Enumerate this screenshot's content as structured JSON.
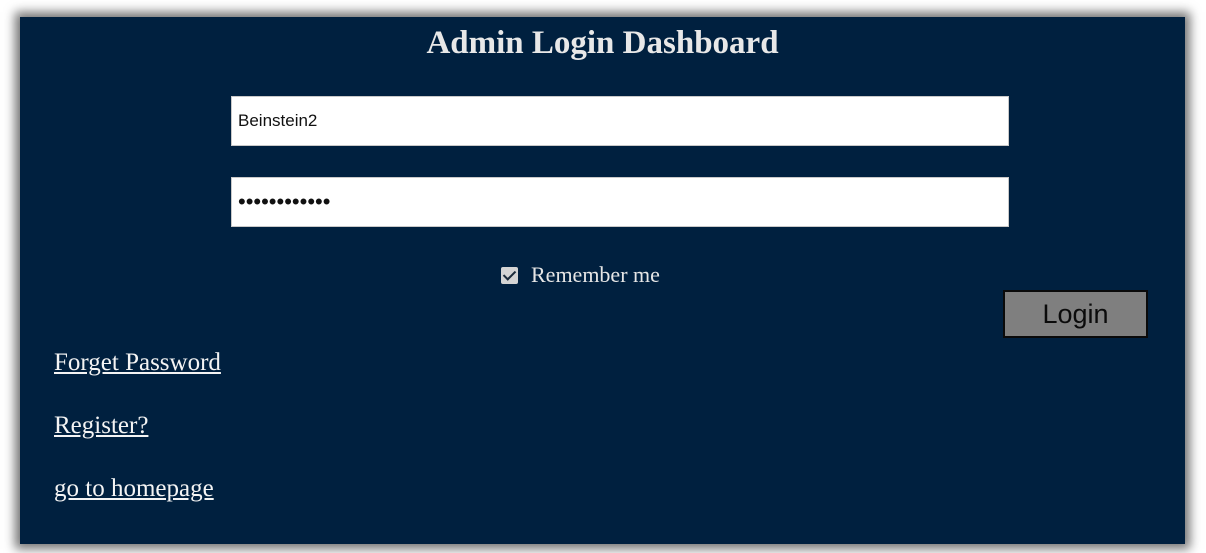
{
  "title": "Admin Login Dashboard",
  "form": {
    "username_value": "Beinstein2",
    "password_value": "••••••••••••",
    "remember_label": "Remember me",
    "remember_checked": true,
    "login_label": "Login"
  },
  "links": {
    "forget_password": "Forget Password",
    "register": "Register?",
    "homepage": "go to homepage"
  },
  "colors": {
    "panel_background": "#00203f",
    "button_background": "#7f7f7f",
    "text_light": "#e8e8e8"
  }
}
